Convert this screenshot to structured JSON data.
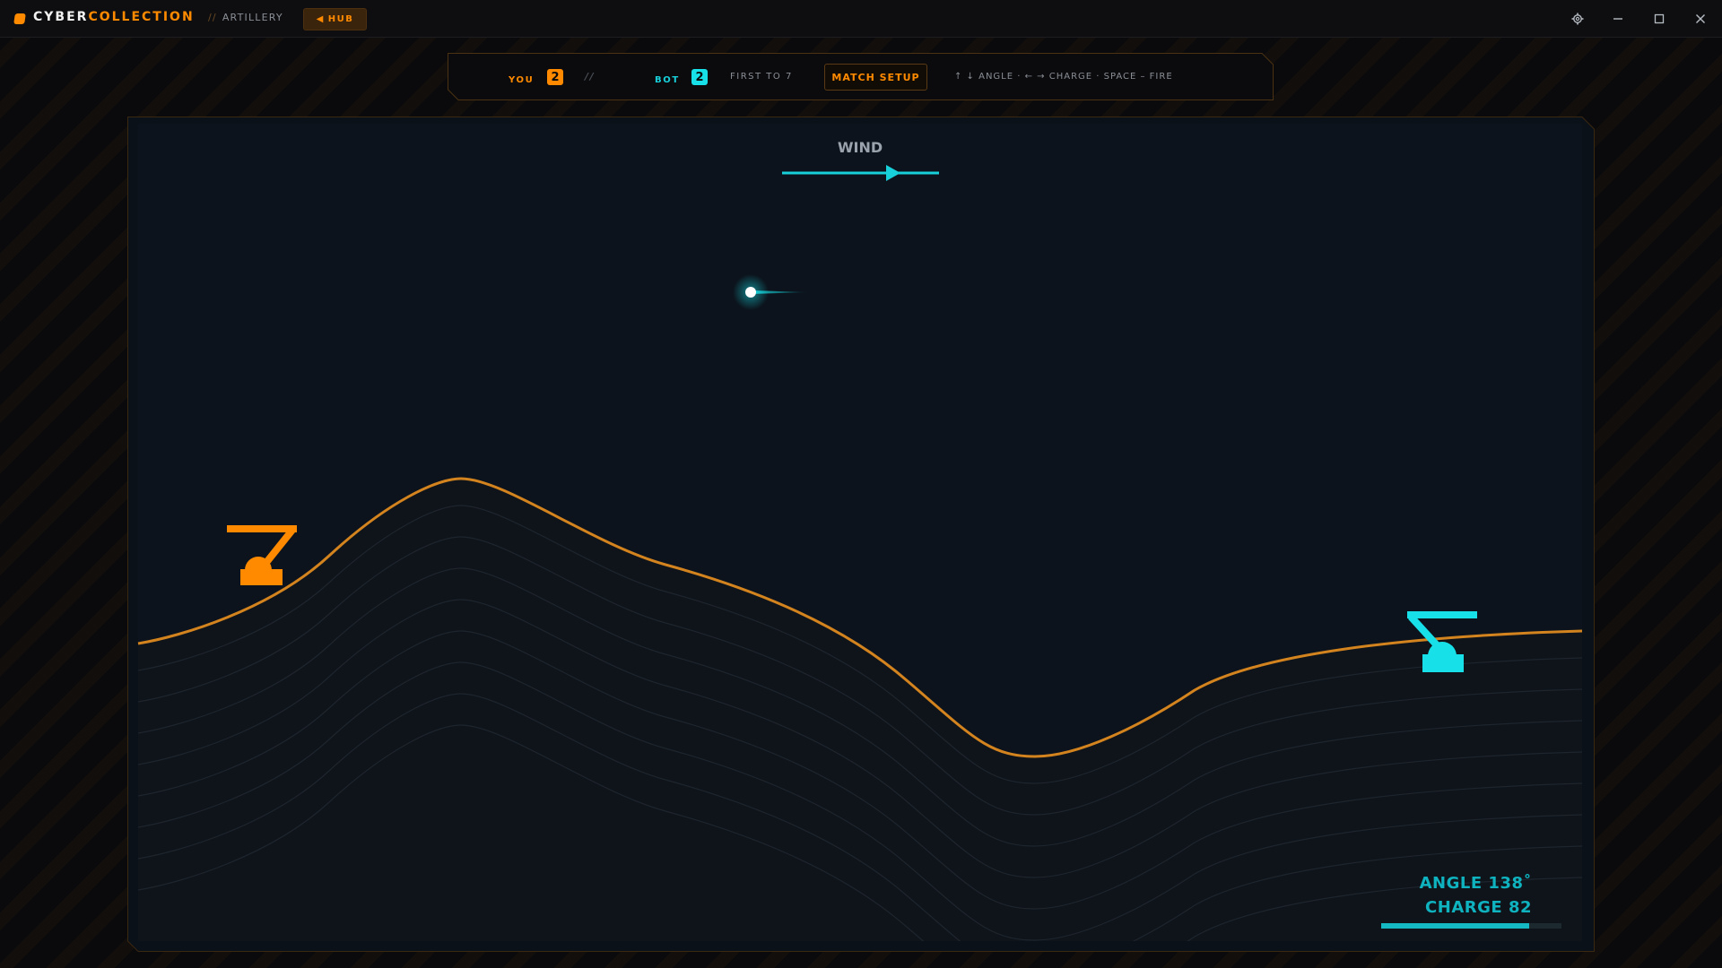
{
  "app": {
    "brand_primary": "CYBER",
    "brand_secondary": "COLLECTION",
    "section_sep": "//",
    "section": "ARTILLERY",
    "hub_label": "HUB",
    "window_controls": [
      "gear-icon",
      "minimize-icon",
      "maximize-icon",
      "close-icon"
    ]
  },
  "hud": {
    "you_label": "YOU",
    "you_score": "2",
    "separator": "//",
    "bot_label": "BOT",
    "bot_score": "2",
    "match_rule": "FIRST TO 7",
    "match_setup_label": "MATCH SETUP",
    "controls_hint": "↑ ↓ ANGLE · ← → CHARGE · SPACE – FIRE"
  },
  "game": {
    "wind_label": "WIND",
    "wind_direction": "right",
    "angle_readout": "ANGLE 138˚",
    "charge_readout": "CHARGE 82",
    "charge_value": 82,
    "charge_max": 100,
    "player_tank": "orange",
    "bot_tank": "cyan"
  },
  "colors": {
    "accent_orange": "#ff8a00",
    "accent_cyan": "#17e0e8",
    "terrain_line": "#d4841e",
    "field_bg": "#0b1119"
  }
}
